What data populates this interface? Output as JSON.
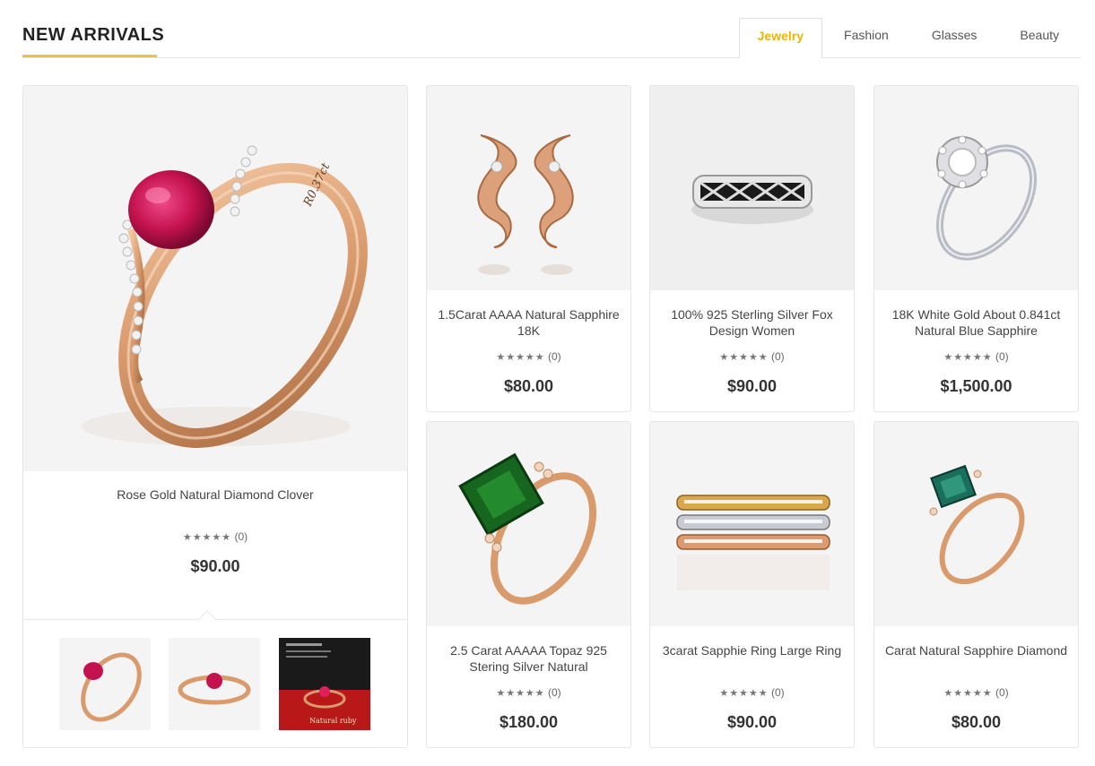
{
  "header": {
    "title": "NEW ARRIVALS",
    "accent_color": "#f0c040",
    "tabs": [
      {
        "label": "Jewelry",
        "active": true
      },
      {
        "label": "Fashion",
        "active": false
      },
      {
        "label": "Glasses",
        "active": false
      },
      {
        "label": "Beauty",
        "active": false
      }
    ]
  },
  "featured": {
    "name": "Rose Gold Natural Diamond Clover",
    "stars": "★★★★★",
    "reviews": "(0)",
    "price": "$90.00",
    "thumbnails": [
      {
        "icon": "ruby-ring-thumb"
      },
      {
        "icon": "ruby-ring-side-thumb"
      },
      {
        "icon": "ruby-ring-box-thumb",
        "caption": "Natural ruby"
      }
    ]
  },
  "products": [
    {
      "name": "1.5Carat AAAA Natural Sapphire 18K",
      "stars": "★★★★★",
      "reviews": "(0)",
      "price": "$80.00",
      "icon": "earrings"
    },
    {
      "name": "100% 925 Sterling Silver Fox Design Women",
      "stars": "★★★★★",
      "reviews": "(0)",
      "price": "$90.00",
      "icon": "silver-band-ring"
    },
    {
      "name": "18K White Gold About 0.841ct Natural Blue Sapphire",
      "stars": "★★★★★",
      "reviews": "(0)",
      "price": "$1,500.00",
      "icon": "diamond-halo-ring"
    },
    {
      "name": "2.5 Carat AAAAA Topaz 925 Stering Silver Natural",
      "stars": "★★★★★",
      "reviews": "(0)",
      "price": "$180.00",
      "icon": "emerald-ring"
    },
    {
      "name": "3carat Sapphie Ring Large Ring",
      "stars": "★★★★★",
      "reviews": "(0)",
      "price": "$90.00",
      "icon": "stacked-rings"
    },
    {
      "name": "Carat Natural Sapphire Diamond",
      "stars": "★★★★★",
      "reviews": "(0)",
      "price": "$80.00",
      "icon": "green-gem-ring"
    }
  ]
}
